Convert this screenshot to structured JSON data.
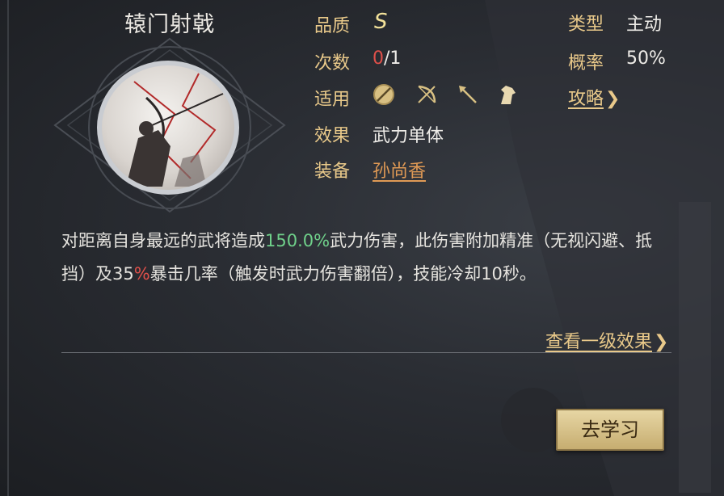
{
  "skill": {
    "name": "辕门射戟",
    "quality_label": "品质",
    "quality_value": "S",
    "count_label": "次数",
    "count_used": "0",
    "count_total": "/1",
    "applies_label": "适用",
    "applies_icons": [
      "shield-icon",
      "bow-icon",
      "spear-icon",
      "horse-icon"
    ],
    "effect_label": "效果",
    "effect_value": "武力单体",
    "equip_label": "装备",
    "equip_value": "孙尚香",
    "type_label": "类型",
    "type_value": "主动",
    "rate_label": "概率",
    "rate_value": "50%",
    "guide_link": "攻略"
  },
  "description": {
    "part1": "对距离自身最远的武将造成",
    "highlight": "150.0%",
    "part2": "武力伤害，此伤害附加精准（无视闪避、抵挡）及35",
    "percent": "%",
    "part3": "暴击几率（触发时武力伤害翻倍），技能冷却10秒。"
  },
  "view_level1_link": "查看一级效果",
  "learn_button": "去学习",
  "colors": {
    "label_gold": "#e9c98a",
    "highlight_green": "#6fd08a",
    "count_red": "#e0504a",
    "button_gold": "#d8c083"
  }
}
